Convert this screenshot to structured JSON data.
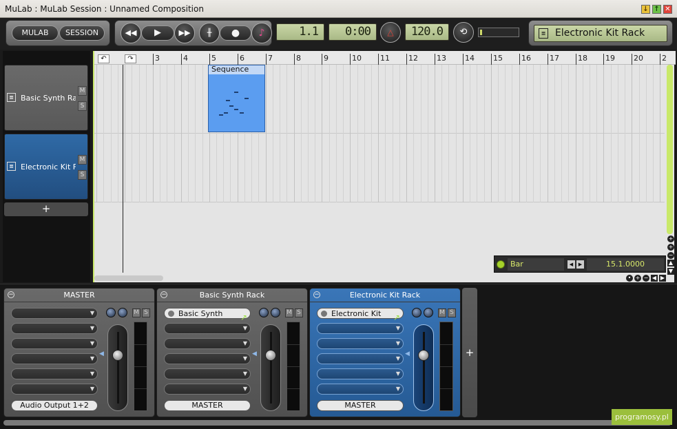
{
  "window": {
    "title": "MuLab : MuLab Session : Unnamed Composition"
  },
  "toolbar": {
    "mulab_label": "MULAB",
    "session_label": "SESSION",
    "position": "1.1",
    "time": "0:00",
    "tempo": "120.0",
    "rack_name": "Electronic Kit Rack"
  },
  "tracks": [
    {
      "name": "Basic Synth Ra",
      "m": "M",
      "s": "S"
    },
    {
      "name": "Electronic Kit F",
      "m": "M",
      "s": "S"
    }
  ],
  "add_track_label": "+",
  "ruler": {
    "bars": [
      "3",
      "4",
      "5",
      "6",
      "7",
      "8",
      "9",
      "10",
      "11",
      "12",
      "13",
      "14",
      "15",
      "16",
      "17",
      "18",
      "19",
      "20",
      "2"
    ]
  },
  "clip": {
    "name": "Sequence"
  },
  "snap": {
    "mode": "Bar",
    "position": "15.1.0000"
  },
  "mixer": {
    "strips": [
      {
        "title": "MASTER",
        "instrument": "",
        "output": "Audio Output 1+2",
        "m": "M",
        "s": "S"
      },
      {
        "title": "Basic Synth Rack",
        "instrument": "Basic Synth",
        "output": "MASTER",
        "m": "M",
        "s": "S"
      },
      {
        "title": "Electronic Kit Rack",
        "instrument": "Electronic Kit",
        "output": "MASTER",
        "m": "M",
        "s": "S"
      }
    ],
    "add_label": "+"
  },
  "watermark": "programosy.pl"
}
